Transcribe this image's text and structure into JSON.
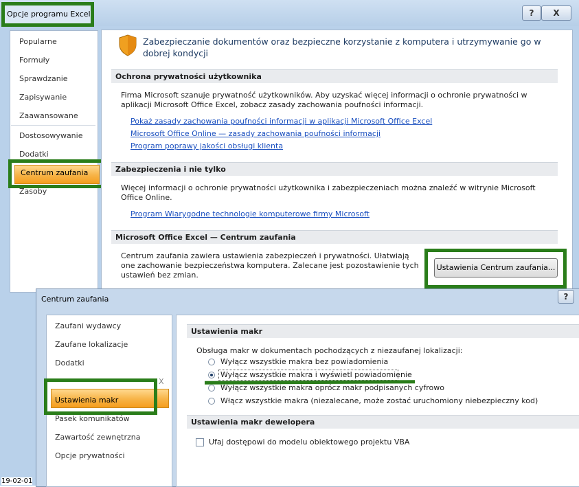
{
  "window1": {
    "title": "Opcje programu Excel",
    "help_btn": "?",
    "close_btn": "X",
    "nav": [
      "Popularne",
      "Formuły",
      "Sprawdzanie",
      "Zapisywanie",
      "Zaawansowane",
      "Dostosowywanie",
      "Dodatki",
      "Centrum zaufania",
      "Zasoby"
    ],
    "header": "Zabezpieczanie dokumentów oraz bezpieczne korzystanie z komputera i utrzymywanie go w dobrej kondycji",
    "privacy": {
      "heading": "Ochrona prywatności użytkownika",
      "text": "Firma Microsoft szanuje prywatność użytkowników. Aby uzyskać więcej informacji o ochronie prywatności w aplikacji Microsoft Office Excel, zobacz zasady zachowania poufności informacji.",
      "links": [
        "Pokaż zasady zachowania poufności informacji w aplikacji Microsoft Office Excel",
        "Microsoft Office Online — zasady zachowania poufności informacji",
        "Program poprawy jakości obsługi klienta"
      ]
    },
    "security": {
      "heading": "Zabezpieczenia i nie tylko",
      "text": "Więcej informacji o ochronie prywatności użytkownika i zabezpieczeniach można znaleźć w witrynie Microsoft Office Online.",
      "link": "Program Wiarygodne technologie komputerowe firmy Microsoft"
    },
    "trust": {
      "heading": "Microsoft Office Excel — Centrum zaufania",
      "text": "Centrum zaufania zawiera ustawienia zabezpieczeń i prywatności. Ułatwiają one zachowanie bezpieczeństwa komputera. Zalecane jest pozostawienie tych ustawień bez zmian.",
      "button": "Ustawienia Centrum zaufania..."
    }
  },
  "window2": {
    "title": "Centrum zaufania",
    "help_btn": "?",
    "nav": [
      "Zaufani wydawcy",
      "Zaufane lokalizacje",
      "Dodatki",
      "Ustawienia makr",
      "Pasek komunikatów",
      "Zawartość zewnętrzna",
      "Opcje prywatności"
    ],
    "nav_partial": "X",
    "macros": {
      "heading": "Ustawienia makr",
      "intro": "Obsługa makr w dokumentach pochodzących z niezaufanej lokalizacji:",
      "options": [
        "Wyłącz wszystkie makra bez powiadomienia",
        "Wyłącz wszystkie makra i wyświetl powiadomienie",
        "Wyłącz wszystkie makra oprócz makr podpisanych cyfrowo",
        "Włącz wszystkie makra (niezalecane, może zostać uruchomiony niebezpieczny kod)"
      ],
      "selected_index": 1
    },
    "developer": {
      "heading": "Ustawienia makr dewelopera",
      "checkbox": "Ufaj dostępowi do modelu obiektowego projektu VBA"
    }
  },
  "date_stamp": "19-02-01"
}
